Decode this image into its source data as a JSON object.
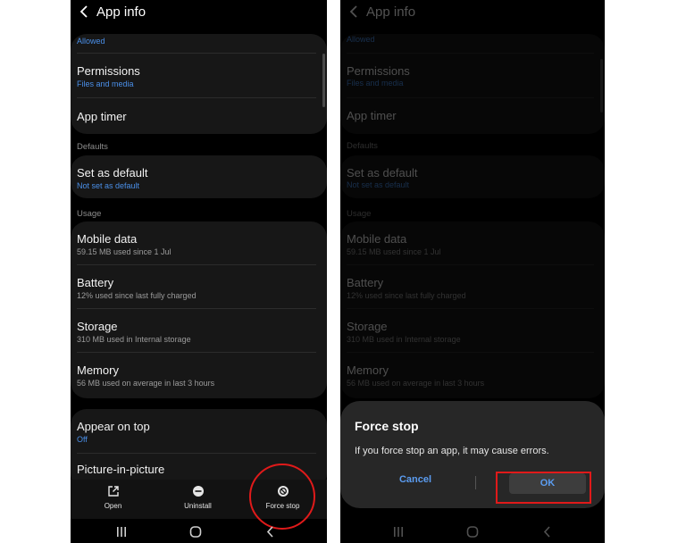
{
  "header": {
    "title": "App info"
  },
  "top_item": {
    "sub": "Allowed"
  },
  "permissions": {
    "label": "Permissions",
    "sub": "Files and media"
  },
  "app_timer": {
    "label": "App timer"
  },
  "defaults": {
    "section": "Defaults",
    "set_default": {
      "label": "Set as default",
      "sub": "Not set as default"
    }
  },
  "usage": {
    "section": "Usage",
    "items": [
      {
        "label": "Mobile data",
        "sub": "59.15 MB used since 1 Jul"
      },
      {
        "label": "Battery",
        "sub": "12% used since last fully charged"
      },
      {
        "label": "Storage",
        "sub": "310 MB used in Internal storage"
      },
      {
        "label": "Memory",
        "sub": "56 MB used on average in last 3 hours"
      }
    ]
  },
  "appear_on_top": {
    "label": "Appear on top",
    "sub": "Off"
  },
  "picture_in_picture": {
    "label": "Picture-in-picture"
  },
  "actions": {
    "open": {
      "label": "Open",
      "icon": "open-external-icon"
    },
    "uninstall": {
      "label": "Uninstall",
      "icon": "minus-circle-icon"
    },
    "force_stop": {
      "label": "Force stop",
      "icon": "force-stop-icon"
    }
  },
  "dialog": {
    "title": "Force stop",
    "message": "If you force stop an app, it may cause errors.",
    "cancel": "Cancel",
    "ok": "OK"
  },
  "colors": {
    "background": "#000000",
    "card": "#171717",
    "accent_blue": "#4a8fe8",
    "highlight_red": "#e01a1a",
    "dialog_bg": "#272727"
  }
}
